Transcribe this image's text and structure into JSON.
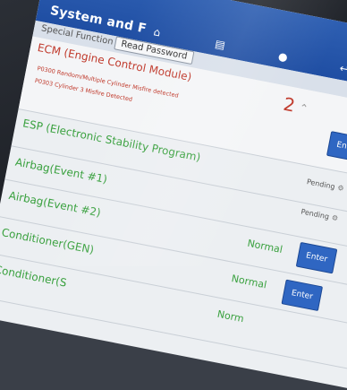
{
  "window": {
    "title": "System and F"
  },
  "toolbar": {
    "special_function": "Special Function",
    "read_password": "Read Password",
    "icons": [
      "home-icon",
      "document-icon",
      "person-icon",
      "back-icon"
    ]
  },
  "modules": [
    {
      "name": "ECM (Engine Control Module)",
      "dtcs": [
        "P0300 Random/Multiple Cylinder Misfire detected",
        "P0303 Cylinder 3 Misfire Detected"
      ],
      "count": "2",
      "enter_label": "Enter"
    },
    {
      "name": "ESP (Electronic Stability Program)",
      "status": "Pending"
    },
    {
      "name": "Airbag(Event #1)",
      "status": "Pending"
    },
    {
      "name": "Airbag(Event #2)",
      "status": "Normal",
      "enter_label": "Enter"
    },
    {
      "name": "Conditioner(GEN)",
      "status": "Normal",
      "enter_label": "Enter"
    },
    {
      "name": "Conditioner(S",
      "status": "Norm"
    }
  ],
  "colors": {
    "header": "#1f4ea3",
    "ok": "#3aa13f",
    "fault": "#c0392b",
    "button": "#2f66c2"
  }
}
